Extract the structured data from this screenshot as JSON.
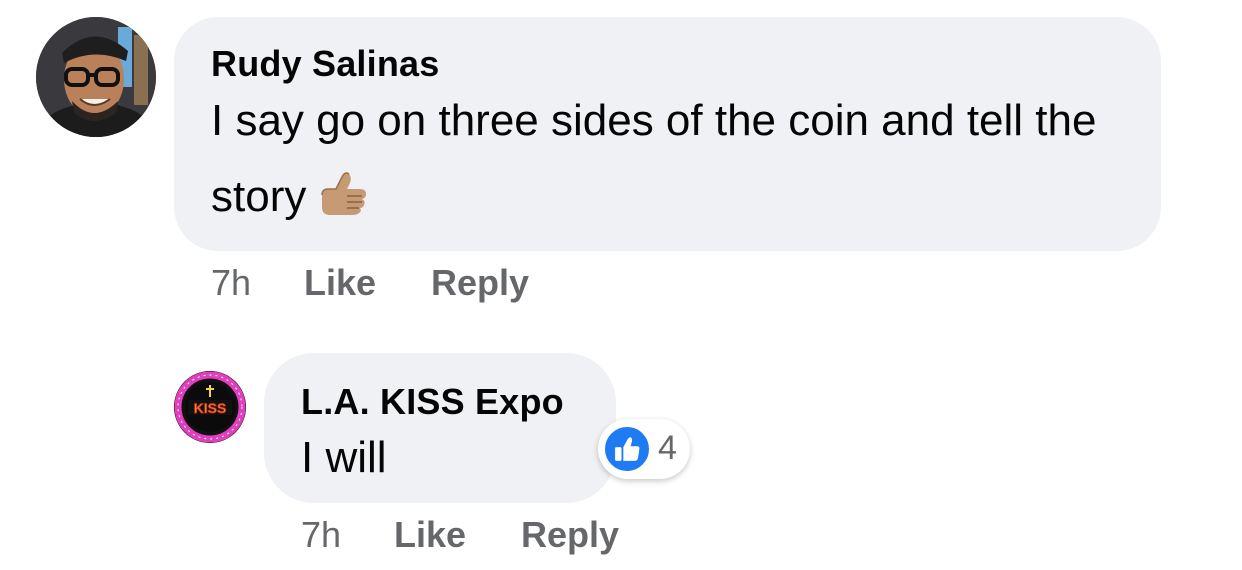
{
  "comments": [
    {
      "author": "Rudy Salinas",
      "text": "I say go on three sides of the coin  and tell the story",
      "emoji": "thumbs-up-medium-skin",
      "time": "7h",
      "like_label": "Like",
      "reply_label": "Reply"
    },
    {
      "author": "L.A. KISS Expo",
      "text": "I will",
      "time": "7h",
      "like_label": "Like",
      "reply_label": "Reply",
      "reaction": {
        "icon": "like-icon",
        "count": "4",
        "color": "#1f7bf2"
      },
      "avatar_logo_text": "KISS"
    }
  ],
  "colors": {
    "bubble": "#f0f1f4",
    "secondary_text": "#65676b",
    "primary_text": "#050505",
    "like_blue": "#1f7bf2",
    "kiss_ring": "#e23fbf"
  }
}
